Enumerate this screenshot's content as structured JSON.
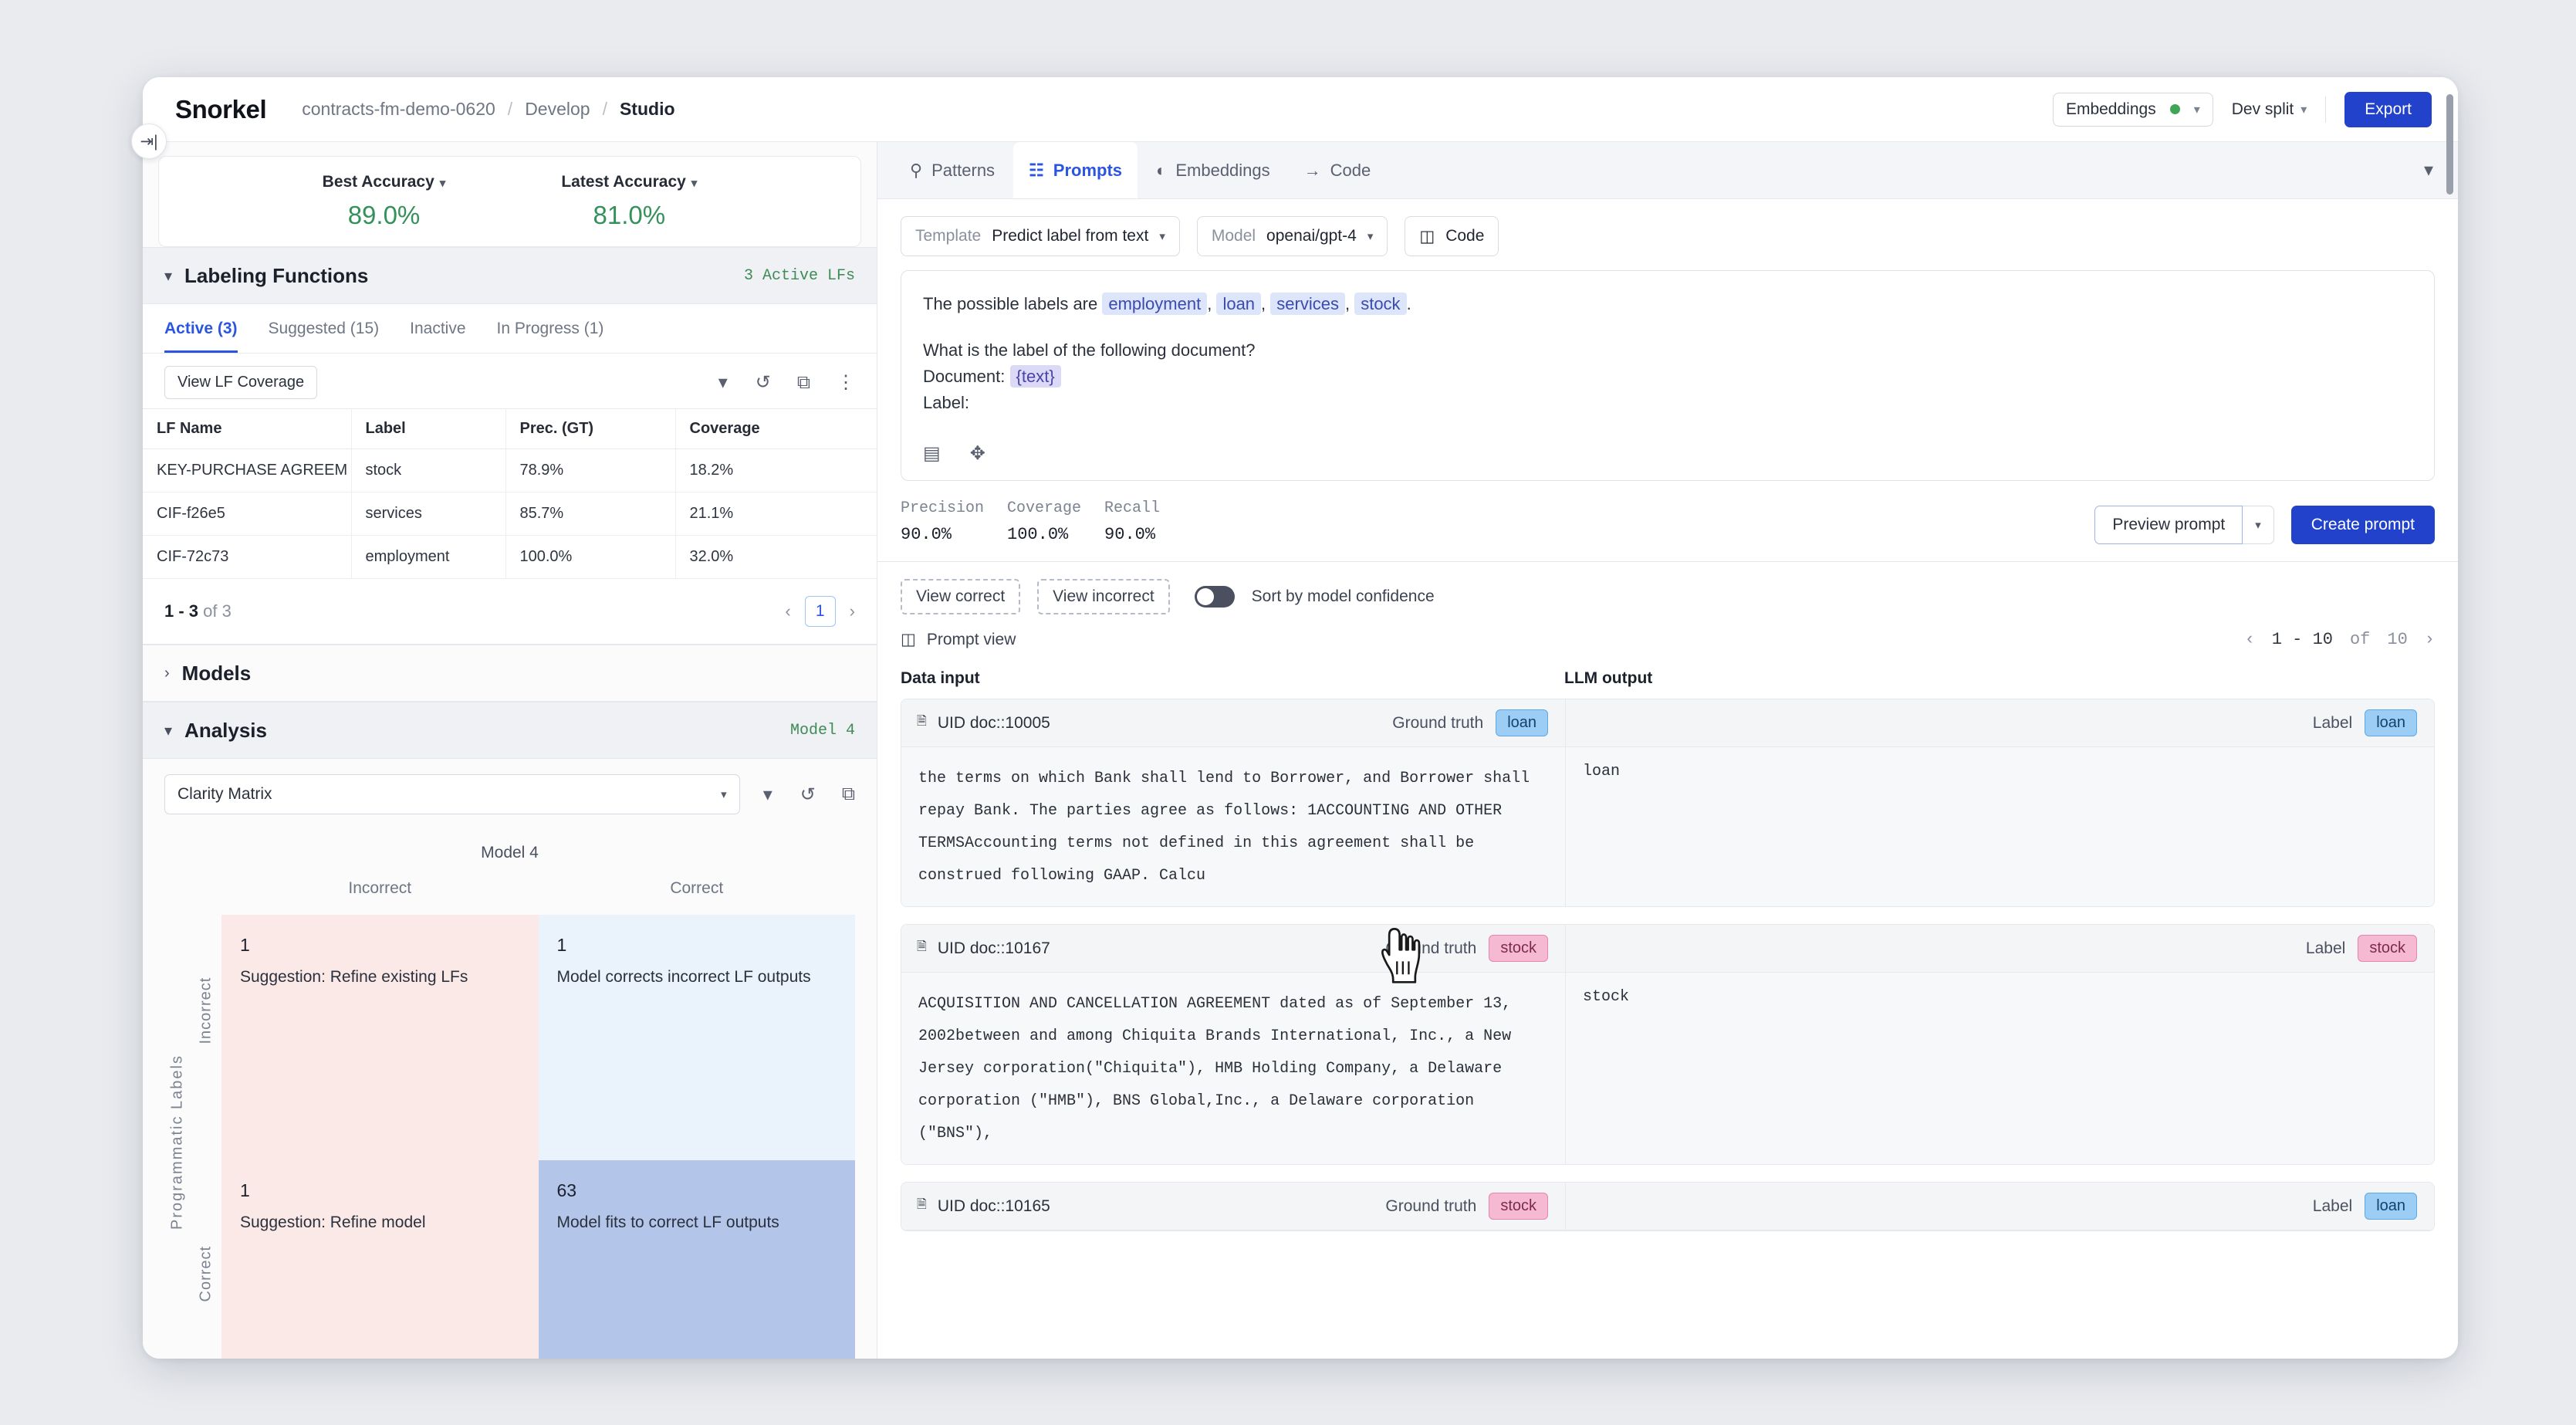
{
  "header": {
    "brand": "Snorkel",
    "breadcrumbs": [
      "contracts-fm-demo-0620",
      "Develop",
      "Studio"
    ],
    "separator": "/",
    "embeddings_label": "Embeddings",
    "dev_split_label": "Dev split",
    "export_label": "Export",
    "accent_color": "#2242cc"
  },
  "left": {
    "accuracy": [
      {
        "label": "Best Accuracy",
        "value": "89.0%"
      },
      {
        "label": "Latest Accuracy",
        "value": "81.0%"
      }
    ],
    "labeling_functions": {
      "title": "Labeling Functions",
      "active_count": "3 Active LFs",
      "tabs": [
        "Active (3)",
        "Suggested (15)",
        "Inactive",
        "In Progress (1)"
      ],
      "active_tab": "Active (3)",
      "view_coverage_label": "View LF Coverage",
      "columns": [
        "LF Name",
        "Label",
        "Prec. (GT)",
        "Coverage"
      ],
      "rows": [
        {
          "name": "KEY-PURCHASE AGREEM",
          "label": "stock",
          "label_class": "lbl-stock",
          "precision": "78.9%",
          "precision_class": "",
          "coverage": "18.2%"
        },
        {
          "name": "CIF-f26e5",
          "label": "services",
          "label_class": "lbl-services",
          "precision": "85.7%",
          "precision_class": "",
          "coverage": "21.1%"
        },
        {
          "name": "CIF-72c73",
          "label": "employment",
          "label_class": "lbl-employment",
          "precision": "100.0%",
          "precision_class": "val-green",
          "coverage": "32.0%"
        }
      ],
      "pager": {
        "range": "1 - 3",
        "of": "of",
        "total": "3",
        "page": "1"
      }
    },
    "models_title": "Models",
    "analysis": {
      "title": "Analysis",
      "model_tag": "Model 4",
      "selected_view": "Clarity Matrix"
    }
  },
  "chart_data": {
    "type": "heatmap",
    "title": "Model 4",
    "xlabel": "",
    "ylabel": "Programmatic Labels",
    "x_categories": [
      "Incorrect",
      "Correct"
    ],
    "y_categories": [
      "Incorrect",
      "Correct"
    ],
    "cells": [
      {
        "x": "Incorrect",
        "y": "Incorrect",
        "value": "1",
        "desc": "Suggestion: Refine existing LFs",
        "color": "#fbe9e8"
      },
      {
        "x": "Correct",
        "y": "Incorrect",
        "value": "1",
        "desc": "Model corrects incorrect LF outputs",
        "color": "#eaf2fb"
      },
      {
        "x": "Incorrect",
        "y": "Correct",
        "value": "1",
        "desc": "Suggestion: Refine model",
        "color": "#fbe9e8"
      },
      {
        "x": "Correct",
        "y": "Correct",
        "value": "63",
        "desc": "Model fits to correct LF outputs",
        "color": "#b3c6ea"
      }
    ]
  },
  "right": {
    "tabs": [
      {
        "label": "Patterns",
        "icon": "search-icon",
        "active": false
      },
      {
        "label": "Prompts",
        "icon": "prompts-icon",
        "active": true
      },
      {
        "label": "Embeddings",
        "icon": "scatter-icon",
        "active": false
      },
      {
        "label": "Code",
        "icon": "arrow-right-icon",
        "active": false
      }
    ],
    "prompt_controls": {
      "template_key": "Template",
      "template_value": "Predict label from text",
      "model_key": "Model",
      "model_value": "openai/gpt-4",
      "code_label": "Code"
    },
    "prompt": {
      "line1_prefix": "The possible labels are",
      "labels": [
        "employment",
        "loan",
        "services",
        "stock"
      ],
      "line1_suffix": ".",
      "question": "What is the label of the following document?",
      "document_key": "Document:",
      "document_value": "{text}",
      "label_key": "Label:"
    },
    "metrics": [
      {
        "label": "Precision",
        "value": "90.0%"
      },
      {
        "label": "Coverage",
        "value": "100.0%"
      },
      {
        "label": "Recall",
        "value": "90.0%"
      }
    ],
    "preview_label": "Preview prompt",
    "create_label": "Create prompt",
    "filters": {
      "view_correct": "View correct",
      "view_incorrect": "View incorrect",
      "sort_toggle_label": "Sort by model confidence",
      "prompt_view_label": "Prompt view"
    },
    "pager": {
      "range": "1 - 10",
      "of": "of",
      "total": "10"
    },
    "columns": {
      "data_input": "Data input",
      "llm_output": "LLM output"
    },
    "ground_truth_label": "Ground truth",
    "label_label": "Label",
    "records": [
      {
        "uid": "UID doc::10005",
        "ground_truth": "loan",
        "gt_class": "loan",
        "llm_label": "loan",
        "llm_class": "loan",
        "text": "the terms on which Bank shall lend to Borrower, and Borrower shall repay Bank. The parties agree as follows: 1ACCOUNTING AND OTHER TERMSAccounting terms not defined in this agreement shall be construed following GAAP. Calcu",
        "output": "loan"
      },
      {
        "uid": "UID doc::10167",
        "ground_truth": "stock",
        "gt_class": "stock",
        "llm_label": "stock",
        "llm_class": "stock",
        "text": "ACQUISITION AND CANCELLATION AGREEMENT dated as of September 13, 2002between and among Chiquita Brands International, Inc., a New Jersey corporation(\"Chiquita\"), HMB Holding Company, a Delaware corporation (\"HMB\"), BNS Global,Inc., a Delaware corporation (\"BNS\"),",
        "output": "stock"
      },
      {
        "uid": "UID doc::10165",
        "ground_truth": "stock",
        "gt_class": "stock",
        "llm_label": "loan",
        "llm_class": "loan",
        "text": "",
        "output": ""
      }
    ]
  }
}
